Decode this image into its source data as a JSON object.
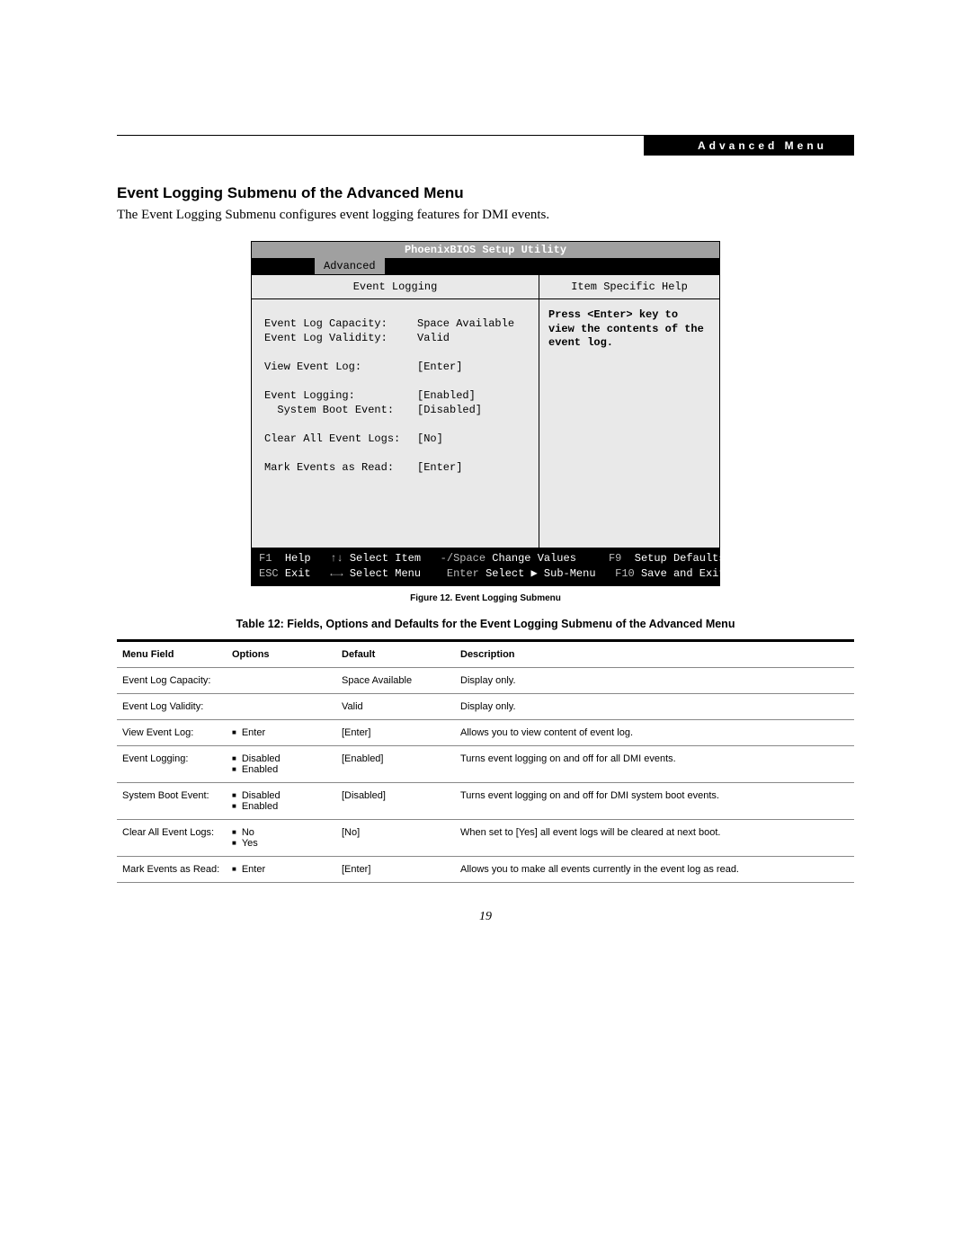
{
  "header": {
    "banner": "Advanced Menu"
  },
  "section": {
    "title": "Event Logging Submenu of the Advanced Menu",
    "intro": "The Event Logging Submenu configures event logging features for DMI events."
  },
  "bios": {
    "title": "PhoenixBIOS Setup Utility",
    "active_tab": "Advanced",
    "submenu_title": "Event Logging",
    "help_title": "Item Specific Help",
    "help_text": "Press <Enter> key to view the contents of the event log.",
    "rows": [
      {
        "label": "Event Log Capacity:",
        "value": "Space Available"
      },
      {
        "label": "Event Log Validity:",
        "value": "Valid"
      },
      {
        "blank": true
      },
      {
        "label": "View Event Log:",
        "value": "[Enter]"
      },
      {
        "blank": true
      },
      {
        "label": "Event Logging:",
        "value": "[Enabled]"
      },
      {
        "label": "  System Boot Event:",
        "value": "[Disabled]"
      },
      {
        "blank": true
      },
      {
        "label": "Clear All Event Logs:",
        "value": "[No]"
      },
      {
        "blank": true
      },
      {
        "label": "Mark Events as Read:",
        "value": "[Enter]"
      }
    ],
    "footer": {
      "f1": "F1",
      "help": "Help",
      "sel_item_key": "↑↓",
      "sel_item": "Select Item",
      "change_key": "-/Space",
      "change": "Change Values",
      "f9": "F9",
      "defaults": "Setup Defaults",
      "esc": "ESC",
      "exit": "Exit",
      "sel_menu_key": "←→",
      "sel_menu": "Select Menu",
      "enter": "Enter",
      "enter_label": "Select ▶ Sub-Menu",
      "f10": "F10",
      "save": "Save and Exit"
    }
  },
  "figure_caption": "Figure 12.  Event Logging Submenu",
  "table_caption": "Table 12: Fields, Options and Defaults for the Event Logging Submenu of the Advanced Menu",
  "table": {
    "headers": {
      "menu": "Menu Field",
      "options": "Options",
      "default": "Default",
      "desc": "Description"
    },
    "rows": [
      {
        "menu": "Event Log Capacity:",
        "options": [],
        "default": "Space Available",
        "desc": "Display only."
      },
      {
        "menu": "Event Log Validity:",
        "options": [],
        "default": "Valid",
        "desc": "Display only."
      },
      {
        "menu": "View Event Log:",
        "options": [
          "Enter"
        ],
        "default": "[Enter]",
        "desc": "Allows you to view content of event log."
      },
      {
        "menu": "Event Logging:",
        "options": [
          "Disabled",
          "Enabled"
        ],
        "default": "[Enabled]",
        "desc": "Turns event logging on and off for all DMI events."
      },
      {
        "menu": "System Boot Event:",
        "indent": true,
        "options": [
          "Disabled",
          "Enabled"
        ],
        "default": "[Disabled]",
        "desc": "Turns event logging on and off for DMI system boot events."
      },
      {
        "menu": "Clear All Event Logs:",
        "options": [
          "No",
          "Yes"
        ],
        "default": "[No]",
        "desc": "When set to [Yes] all event logs will be cleared at next boot."
      },
      {
        "menu": "Mark Events as Read:",
        "options": [
          "Enter"
        ],
        "default": "[Enter]",
        "desc": "Allows you to make all events currently in the event log as read."
      }
    ]
  },
  "page_number": "19"
}
